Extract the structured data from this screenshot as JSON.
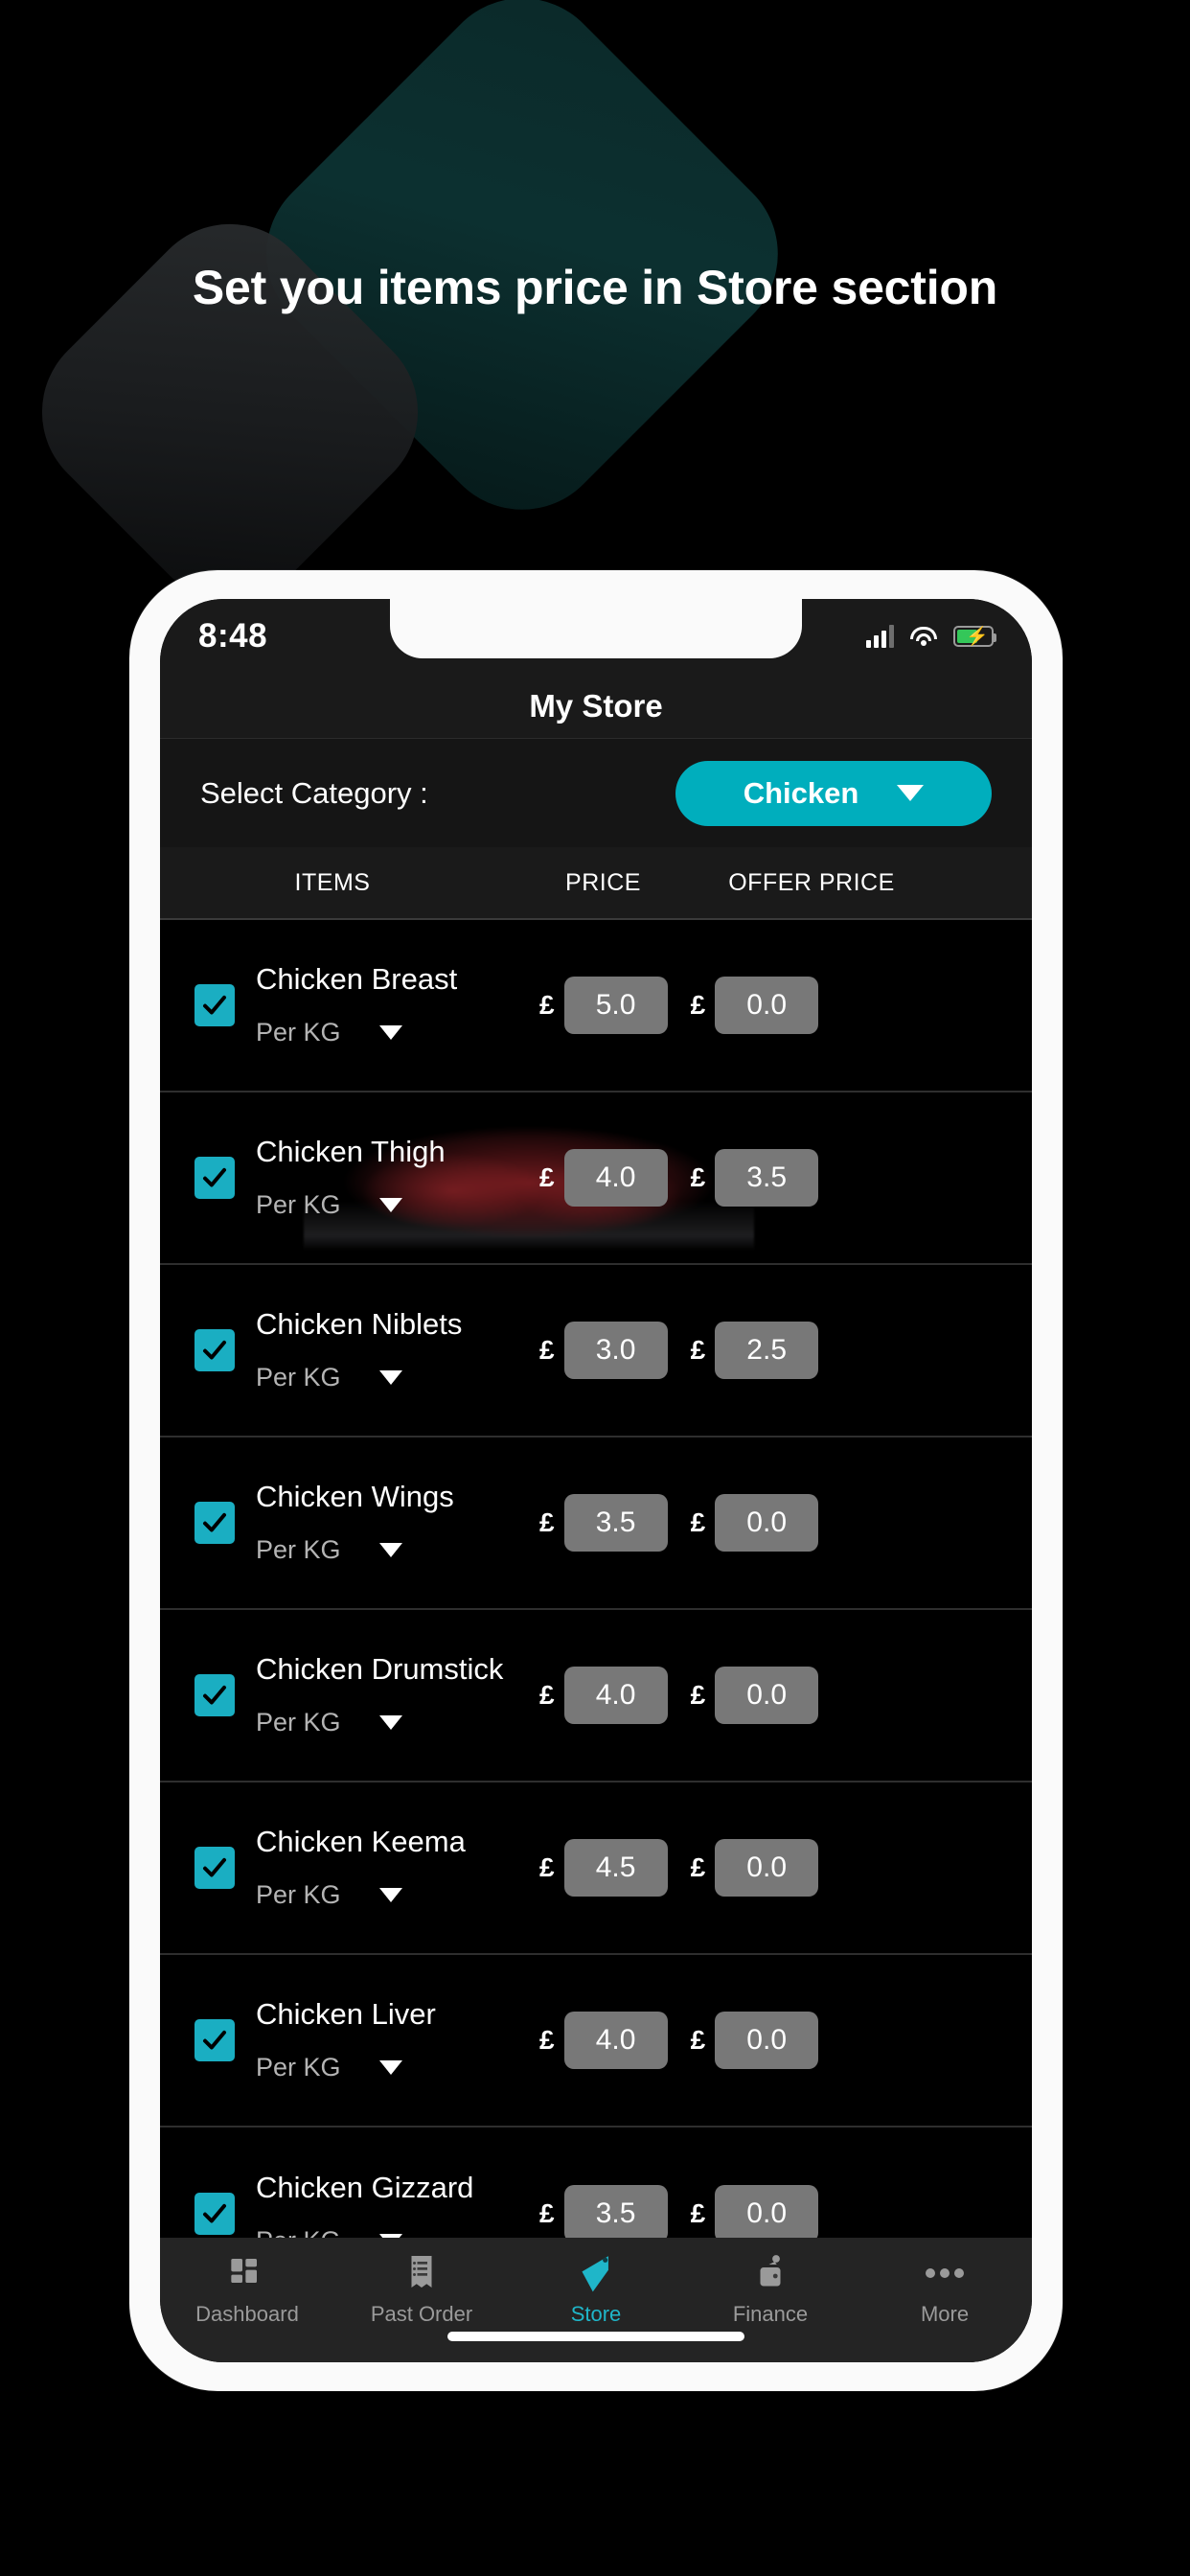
{
  "promo": {
    "headline": "Set you items price in Store section"
  },
  "status_bar": {
    "time": "8:48",
    "signal_icon": "signal-bars-icon",
    "wifi_icon": "wifi-icon",
    "battery_icon": "battery-charging-icon"
  },
  "app": {
    "title": "My Store"
  },
  "category": {
    "label": "Select Category :",
    "selected": "Chicken",
    "caret_icon": "chevron-down-icon"
  },
  "table": {
    "headers": {
      "items": "ITEMS",
      "price": "PRICE",
      "offer_price": "OFFER PRICE"
    },
    "currency": "£",
    "rows": [
      {
        "name": "Chicken Breast",
        "unit": "Per KG",
        "checked": true,
        "price": "5.0",
        "offer": "0.0"
      },
      {
        "name": "Chicken Thigh",
        "unit": "Per KG",
        "checked": true,
        "price": "4.0",
        "offer": "3.5"
      },
      {
        "name": "Chicken Niblets",
        "unit": "Per KG",
        "checked": true,
        "price": "3.0",
        "offer": "2.5"
      },
      {
        "name": "Chicken Wings",
        "unit": "Per KG",
        "checked": true,
        "price": "3.5",
        "offer": "0.0"
      },
      {
        "name": "Chicken Drumstick",
        "unit": "Per KG",
        "checked": true,
        "price": "4.0",
        "offer": "0.0"
      },
      {
        "name": "Chicken Keema",
        "unit": "Per KG",
        "checked": true,
        "price": "4.5",
        "offer": "0.0"
      },
      {
        "name": "Chicken Liver",
        "unit": "Per KG",
        "checked": true,
        "price": "4.0",
        "offer": "0.0"
      },
      {
        "name": "Chicken Gizzard",
        "unit": "Per KG",
        "checked": true,
        "price": "3.5",
        "offer": "0.0"
      }
    ]
  },
  "bottom_nav": {
    "items": [
      {
        "label": "Dashboard",
        "icon": "dashboard-grid-icon",
        "active": false
      },
      {
        "label": "Past Order",
        "icon": "receipt-icon",
        "active": false
      },
      {
        "label": "Store",
        "icon": "price-tag-icon",
        "active": true
      },
      {
        "label": "Finance",
        "icon": "wallet-icon",
        "active": false
      },
      {
        "label": "More",
        "icon": "ellipsis-icon",
        "active": false
      }
    ]
  },
  "colors": {
    "accent_teal": "#00aebd",
    "checkbox_teal": "#1aaec2",
    "active_nav": "#1fb6c9",
    "input_gray": "#787878",
    "page_bg": "#000000"
  }
}
